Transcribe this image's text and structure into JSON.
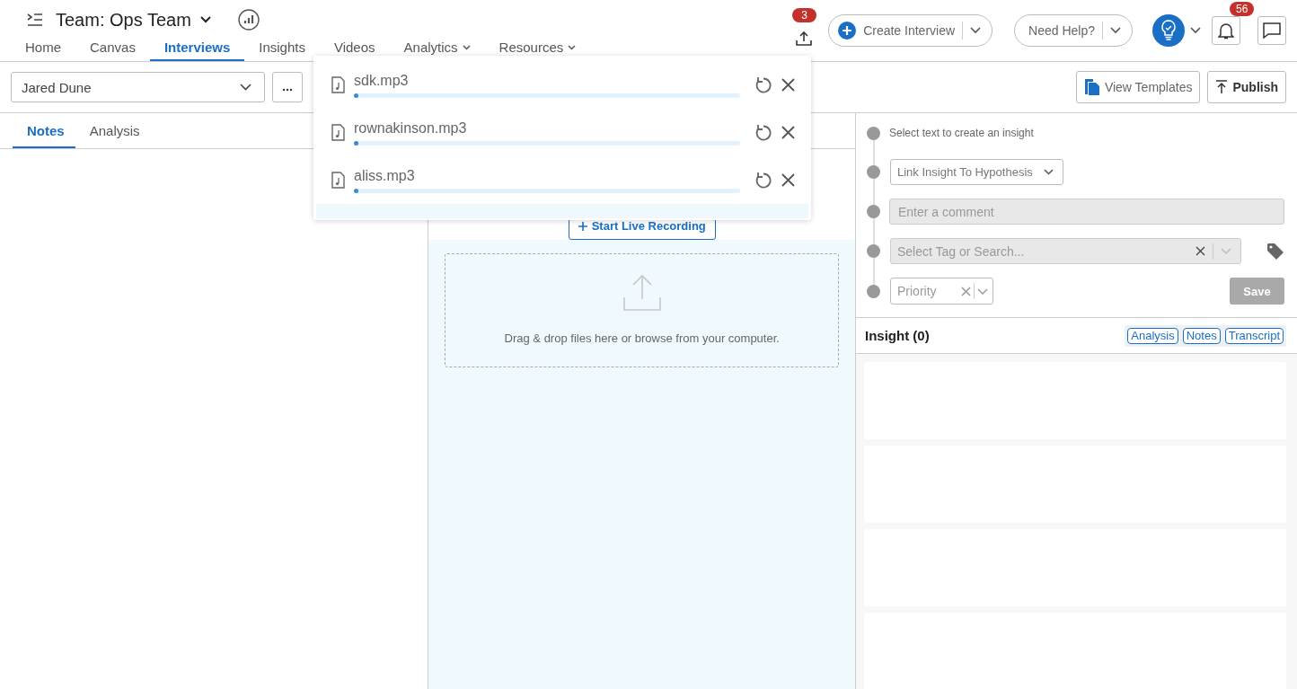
{
  "header": {
    "team_title": "Team: Ops Team"
  },
  "nav": [
    {
      "label": "Home",
      "selected": false,
      "dropdown": false
    },
    {
      "label": "Canvas",
      "selected": false,
      "dropdown": false
    },
    {
      "label": "Interviews",
      "selected": true,
      "dropdown": false
    },
    {
      "label": "Insights",
      "selected": false,
      "dropdown": false
    },
    {
      "label": "Videos",
      "selected": false,
      "dropdown": false
    },
    {
      "label": "Analytics",
      "selected": false,
      "dropdown": true
    },
    {
      "label": "Resources",
      "selected": false,
      "dropdown": true
    }
  ],
  "upload_badge": "3",
  "create_button": "Create Interview",
  "help_button": "Need Help?",
  "notification_badge": "56",
  "toolbar": {
    "interviewee": "Jared Dune",
    "view_templates": "View Templates",
    "publish": "Publish"
  },
  "left_tabs": [
    {
      "label": "Notes",
      "selected": true
    },
    {
      "label": "Analysis",
      "selected": false
    }
  ],
  "uploads": [
    {
      "name": "sdk.mp3",
      "level": 0.01
    },
    {
      "name": "rownakinson.mp3",
      "level": 0.01
    },
    {
      "name": "aliss.mp3",
      "level": 0.01
    }
  ],
  "recording_button": "Start Live Recording",
  "dropzone": {
    "text": "Drag & drop files here or browse from your computer."
  },
  "insight_form": {
    "hint": "Select text to create an insight",
    "hypothesis_select": "Link Insight To Hypothesis",
    "comment": {
      "placeholder": "Enter a comment"
    },
    "tag": {
      "placeholder": "Select Tag or Search..."
    },
    "priority": {
      "placeholder": "Priority"
    },
    "save": {
      "label": "Save",
      "disabled": true
    }
  },
  "insights": {
    "title": "Insight (0)",
    "filters": [
      "Analysis",
      "Notes",
      "Transcript"
    ]
  }
}
